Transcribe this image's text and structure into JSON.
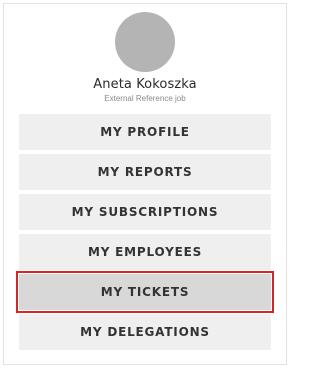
{
  "profile": {
    "name": "Aneta Kokoszka",
    "role": "External Reference job"
  },
  "menu": {
    "items": [
      {
        "label": "MY PROFILE"
      },
      {
        "label": "MY REPORTS"
      },
      {
        "label": "MY SUBSCRIPTIONS"
      },
      {
        "label": "MY EMPLOYEES"
      },
      {
        "label": "MY TICKETS",
        "selected": true
      },
      {
        "label": "MY DELEGATIONS"
      }
    ]
  },
  "colors": {
    "background": "#ffffff",
    "menu_item_bg": "#efefef",
    "menu_item_selected_bg": "#d8d8d8",
    "selection_outline": "#d32626",
    "avatar_placeholder": "#b4b4b4",
    "text": "#333333"
  }
}
